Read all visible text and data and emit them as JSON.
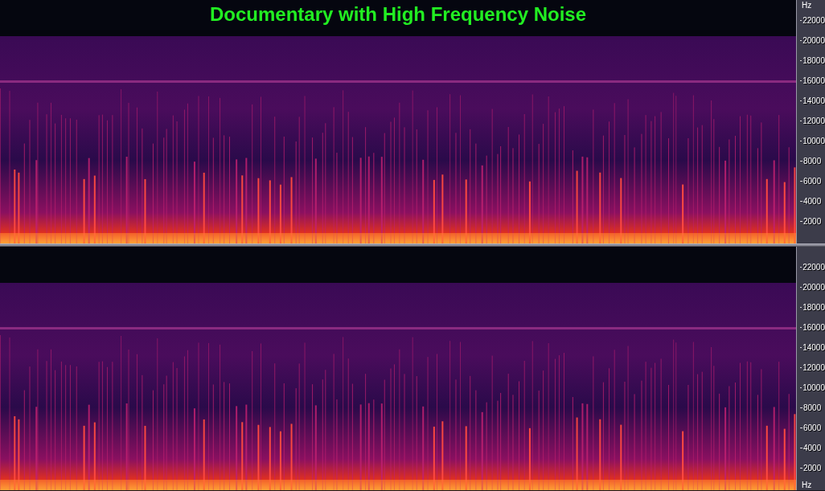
{
  "title": "Documentary with High Frequency Noise",
  "channels": [
    {
      "labels": [
        {
          "kind": "unit",
          "text": "Hz"
        },
        {
          "kind": "tick",
          "text": "22000"
        },
        {
          "kind": "tick",
          "text": "20000"
        },
        {
          "kind": "tick",
          "text": "18000"
        },
        {
          "kind": "tick",
          "text": "16000"
        },
        {
          "kind": "tick",
          "text": "14000"
        },
        {
          "kind": "tick",
          "text": "12000"
        },
        {
          "kind": "tick",
          "text": "10000"
        },
        {
          "kind": "tick",
          "text": "8000"
        },
        {
          "kind": "tick",
          "text": "6000"
        },
        {
          "kind": "tick",
          "text": "4000"
        },
        {
          "kind": "tick",
          "text": "2000"
        }
      ]
    },
    {
      "labels": [
        {
          "kind": "tick",
          "text": "22000"
        },
        {
          "kind": "tick",
          "text": "20000"
        },
        {
          "kind": "tick",
          "text": "18000"
        },
        {
          "kind": "tick",
          "text": "16000"
        },
        {
          "kind": "tick",
          "text": "14000"
        },
        {
          "kind": "tick",
          "text": "12000"
        },
        {
          "kind": "tick",
          "text": "10000"
        },
        {
          "kind": "tick",
          "text": "8000"
        },
        {
          "kind": "tick",
          "text": "6000"
        },
        {
          "kind": "tick",
          "text": "4000"
        },
        {
          "kind": "tick",
          "text": "2000"
        },
        {
          "kind": "unit",
          "text": "Hz"
        }
      ]
    }
  ]
}
